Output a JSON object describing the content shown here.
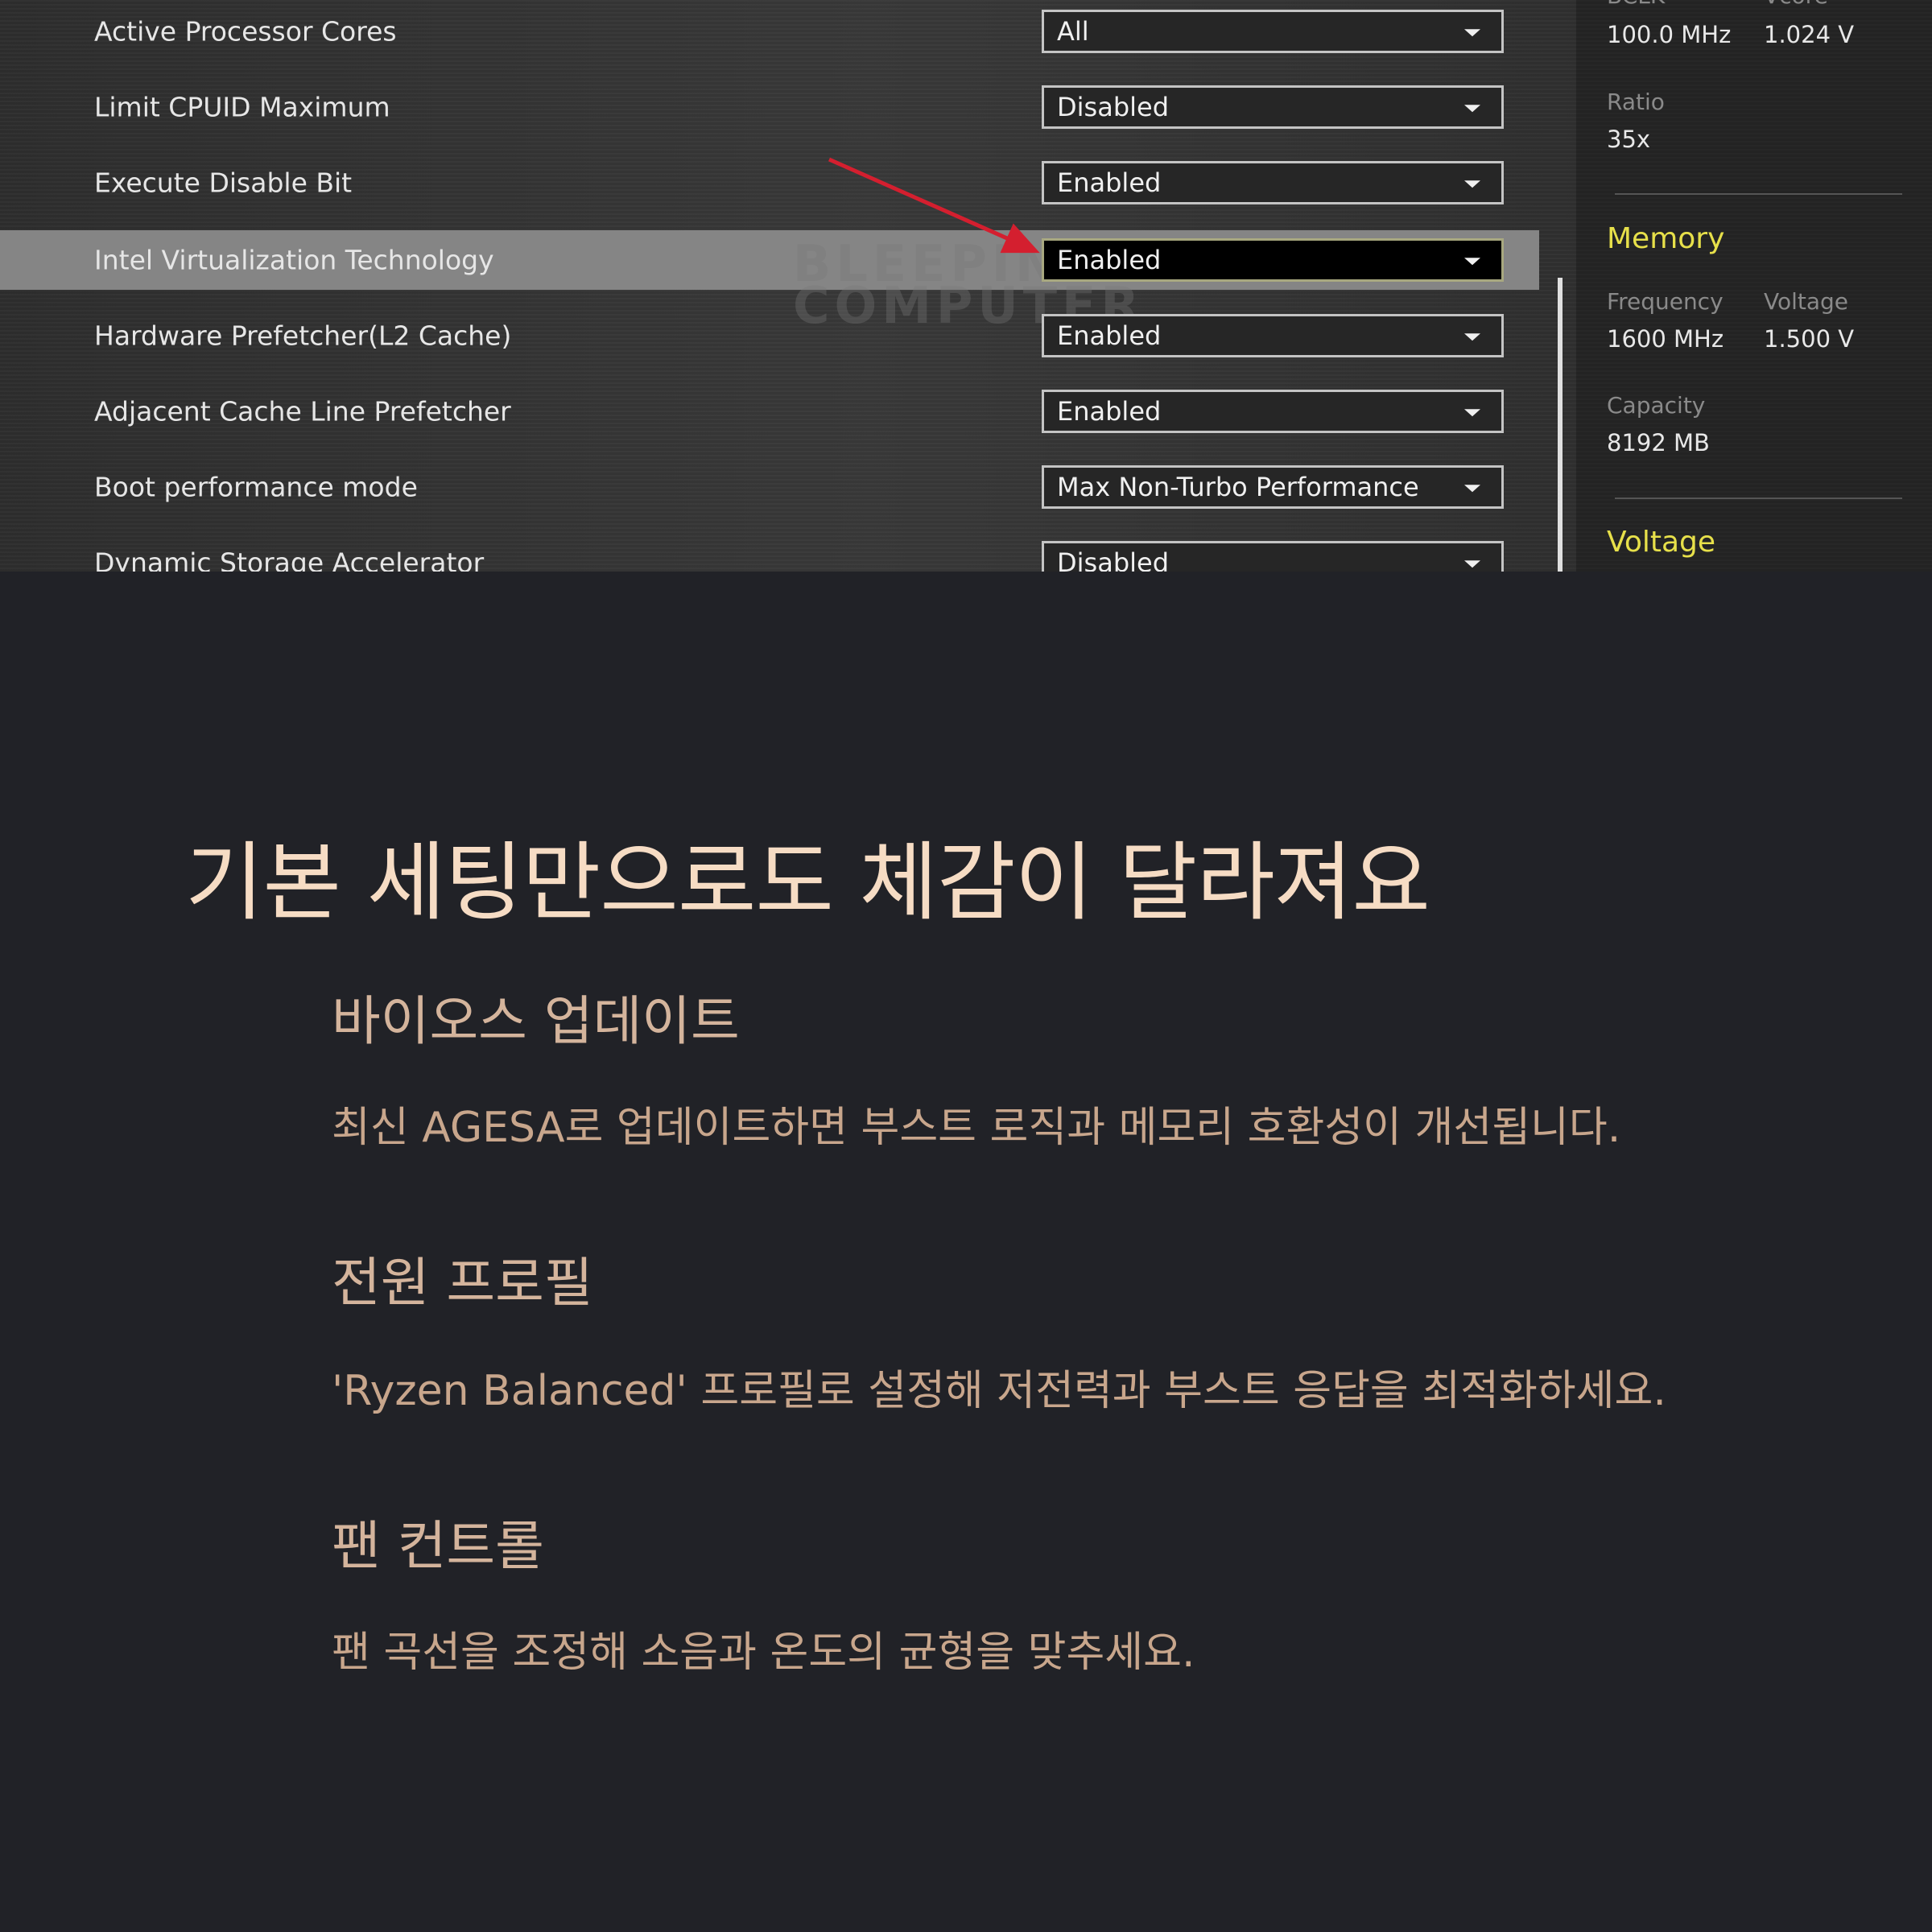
{
  "bios": {
    "settings": [
      {
        "label": "Active Processor Cores",
        "value": "All"
      },
      {
        "label": "Limit CPUID Maximum",
        "value": "Disabled"
      },
      {
        "label": "Execute Disable Bit",
        "value": "Enabled"
      },
      {
        "label": "Intel Virtualization Technology",
        "value": "Enabled",
        "highlighted": true
      },
      {
        "label": "Hardware Prefetcher(L2 Cache)",
        "value": "Enabled"
      },
      {
        "label": "Adjacent Cache Line Prefetcher",
        "value": "Enabled"
      },
      {
        "label": "Boot performance mode",
        "value": "Max Non-Turbo Performance"
      },
      {
        "label": "Dynamic Storage Accelerator",
        "value": "Disabled"
      }
    ],
    "watermark": {
      "line1": "BLEEPING",
      "line2": "COMPUTER"
    },
    "monitor": {
      "top_labels": {
        "bclk": "BCLK",
        "vcore": "Vcore"
      },
      "bclk_value": "100.0 MHz",
      "vcore_value": "1.024 V",
      "ratio_label": "Ratio",
      "ratio_value": "35x",
      "memory_heading": "Memory",
      "frequency_label": "Frequency",
      "frequency_value": "1600 MHz",
      "voltage_label": "Voltage",
      "voltage_value": "1.500 V",
      "capacity_label": "Capacity",
      "capacity_value": "8192 MB",
      "voltage_heading": "Voltage"
    },
    "colors": {
      "highlight_row": "#858585",
      "accent_yellow": "#e7e04a",
      "arrow_red": "#d41f2f"
    }
  },
  "article": {
    "headline": "기본 세팅만으로도 체감이 달라져요",
    "sections": [
      {
        "heading": "바이오스 업데이트",
        "body": "최신 AGESA로 업데이트하면 부스트 로직과 메모리 호환성이 개선됩니다."
      },
      {
        "heading": "전원 프로필",
        "body": "'Ryzen Balanced' 프로필로 설정해 저전력과 부스트 응답을 최적화하세요."
      },
      {
        "heading": "팬 컨트롤",
        "body": "팬 곡선을 조정해 소음과 온도의 균형을 맞추세요."
      }
    ],
    "colors": {
      "background": "#212227",
      "headline": "#f6dcc4",
      "subheading": "#d4b49c",
      "body": "#c8a68c"
    }
  }
}
